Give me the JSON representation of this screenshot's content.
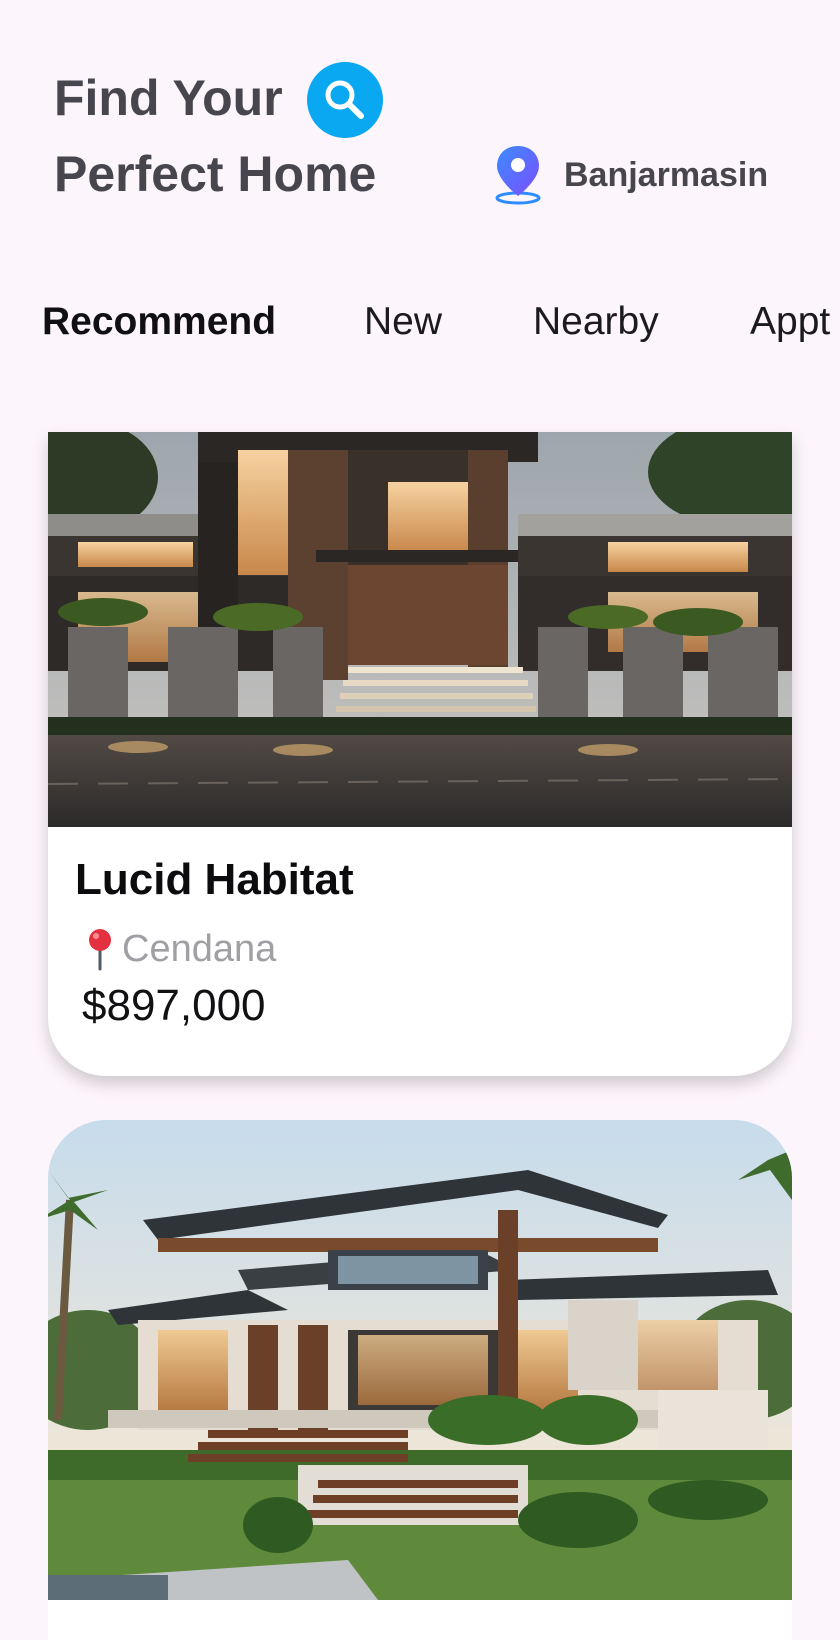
{
  "header": {
    "title_line1": "Find Your",
    "title_line2": "Perfect Home",
    "search_icon": "search-icon",
    "location_icon": "location-pin-icon",
    "location_name": "Banjarmasin"
  },
  "tabs": [
    {
      "label": "Recommend",
      "active": true
    },
    {
      "label": "New",
      "active": false
    },
    {
      "label": "Nearby",
      "active": false
    },
    {
      "label": "Appt",
      "active": false
    }
  ],
  "listings": [
    {
      "name": "Lucid Habitat",
      "location_icon": "pin-icon",
      "location": "Cendana",
      "price": "$897,000"
    },
    {
      "name": "",
      "location": "",
      "price": ""
    }
  ],
  "colors": {
    "background": "#fcf5fb",
    "accent": "#0aa8f0",
    "title": "#47454d",
    "muted": "#a0a0a4"
  }
}
